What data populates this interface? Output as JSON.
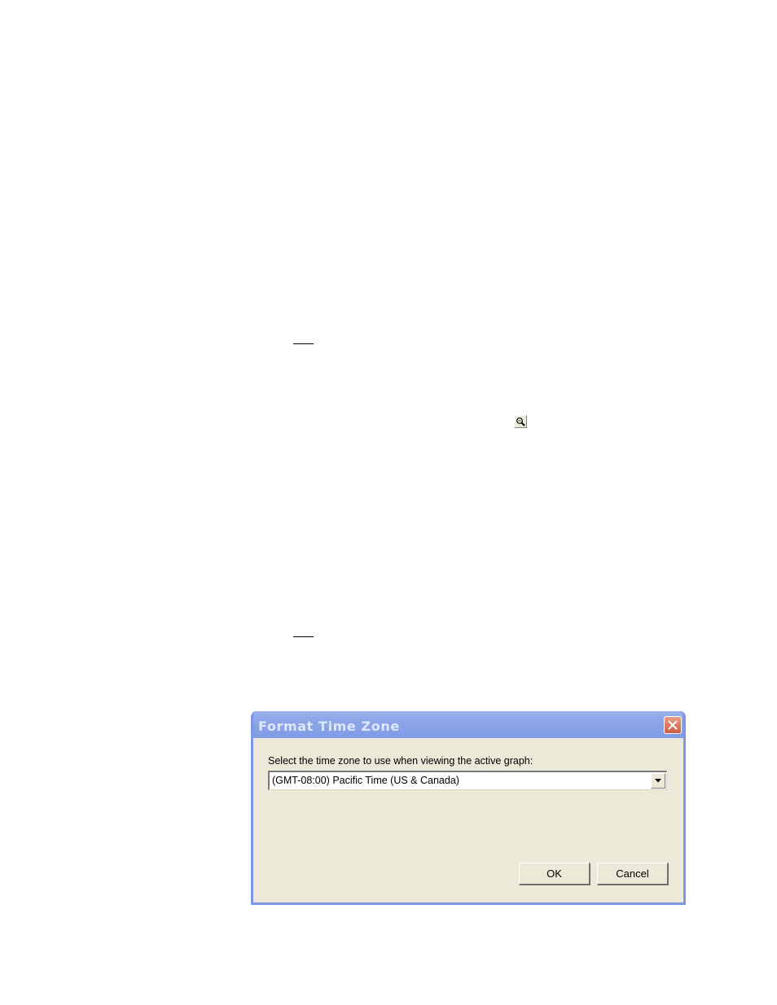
{
  "dialog": {
    "title": "Format Time Zone",
    "prompt": "Select the time zone to use when viewing the active graph:",
    "timezone": {
      "selected": "(GMT-08:00) Pacific Time (US & Canada)"
    },
    "buttons": {
      "ok": "OK",
      "cancel": "Cancel"
    }
  },
  "icons": {
    "zoom": "magnifier-icon",
    "close": "close-icon",
    "dropdown": "chevron-down-icon"
  },
  "colors": {
    "titlebar": "#8ea7e8",
    "client_background": "#ece9d8",
    "close_button": "#d9745a"
  }
}
